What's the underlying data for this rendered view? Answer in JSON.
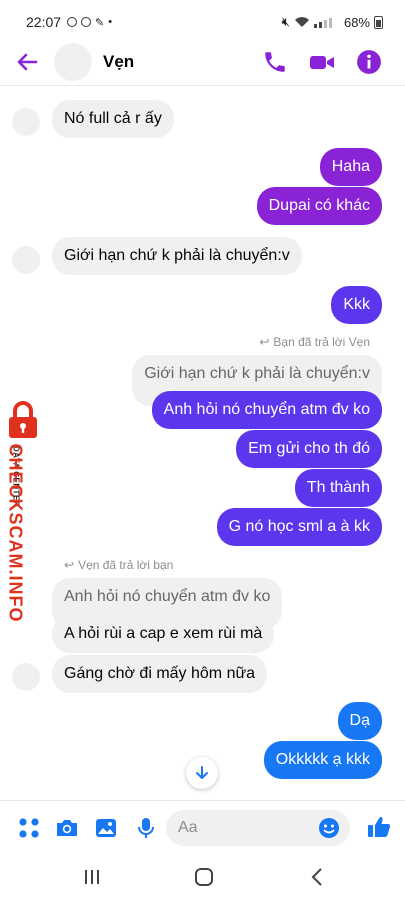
{
  "status": {
    "time": "22:07",
    "battery": "68%"
  },
  "header": {
    "contact_name": "Vẹn"
  },
  "messages": {
    "m1": "Nó full cả r ấy",
    "m2": "Haha",
    "m3": "Dupai có khác",
    "m4": "Giới hạn chứ k phải là chuyển:v",
    "m5": "Kkk",
    "reply1_note": "Bạn đã trả lời Vẹn",
    "reply1_quote": "Giới hạn chứ k phải là chuyển:v",
    "m6": "Anh hỏi nó chuyển atm đv ko",
    "m7": "Em gửi cho th đó",
    "m8": "Th thành",
    "m9": "G nó học sml a à kk",
    "reply2_note": "Vẹn đã trả lời bạn",
    "reply2_quote": "Anh hỏi nó chuyển atm đv ko",
    "m10": "A hỏi rùi a cap e xem rùi mà",
    "m11": "Gáng chờ đi mấy hôm nữa",
    "m12": "Dạ",
    "m13": "Okkkkk ạ kkk"
  },
  "watermark": {
    "brand": "CHECKSCAM.INFO",
    "sub": "DATA CENTER"
  },
  "composer": {
    "placeholder": "Aa"
  },
  "colors": {
    "accent": "#8a22d6",
    "bubble_purple": "#8a22d6",
    "bubble_indigo": "#5b36ec",
    "bubble_blue": "#1877f2",
    "incoming": "#f0f0f0",
    "composer_icon": "#1877f2"
  }
}
